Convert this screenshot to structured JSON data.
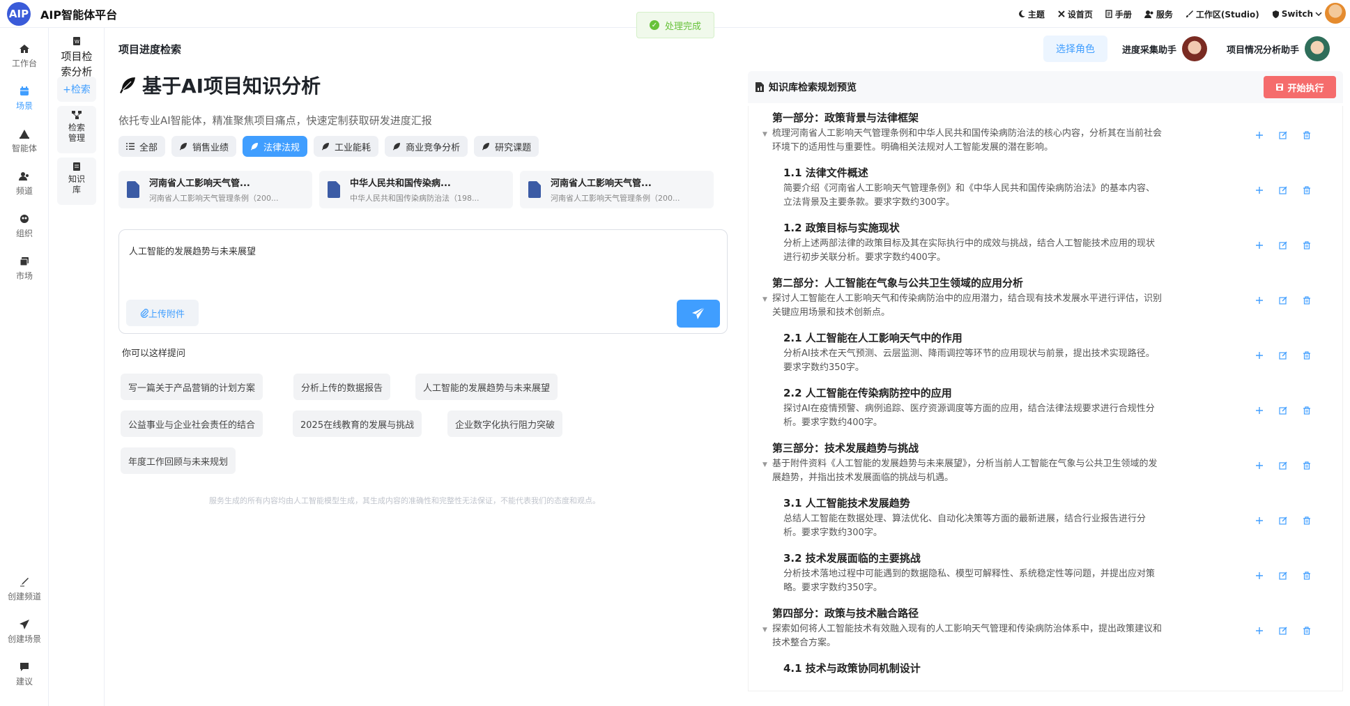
{
  "app": {
    "logo": "AIP",
    "name": "AIP智能体平台"
  },
  "toast": {
    "text": "处理完成"
  },
  "topnav": [
    {
      "icon": "moon-icon",
      "label": "主题"
    },
    {
      "icon": "tools-icon",
      "label": "设首页"
    },
    {
      "icon": "book-icon",
      "label": "手册"
    },
    {
      "icon": "users-icon",
      "label": "服务"
    },
    {
      "icon": "brush-icon",
      "label": "工作区(Studio)"
    },
    {
      "icon": "shield-icon",
      "label": "Switch"
    }
  ],
  "rail": {
    "top": [
      {
        "icon": "home-icon",
        "label": "工作台"
      },
      {
        "icon": "calendar-icon",
        "label": "场景",
        "active": true
      },
      {
        "icon": "agent-icon",
        "label": "智能体"
      },
      {
        "icon": "channel-icon",
        "label": "频道"
      },
      {
        "icon": "org-icon",
        "label": "组织"
      },
      {
        "icon": "market-icon",
        "label": "市场"
      }
    ],
    "bottom": [
      {
        "icon": "pen-icon",
        "label": "创建频道"
      },
      {
        "icon": "send-icon",
        "label": "创建场景"
      },
      {
        "icon": "chat-icon",
        "label": "建议"
      }
    ]
  },
  "submenu": {
    "project": "项目检索分析",
    "search": "+检索",
    "manage": "检索管理",
    "kb": "知识库"
  },
  "main": {
    "page_title": "项目进度检索",
    "hero_title": "基于AI项目知识分析",
    "hero_sub": "依托专业AI智能体，精准聚焦项目痛点，快速定制获取研发进度汇报",
    "chips": [
      "全部",
      "销售业绩",
      "法律法规",
      "工业能耗",
      "商业竞争分析",
      "研究课题"
    ],
    "active_chip": "法律法规",
    "files": [
      {
        "title": "河南省人工影响天气管...",
        "sub": "河南省人工影响天气管理条例（200..."
      },
      {
        "title": "中华人民共和国传染病...",
        "sub": "中华人民共和国传染病防治法（198..."
      },
      {
        "title": "河南省人工影响天气管...",
        "sub": "河南省人工影响天气管理条例（200..."
      }
    ],
    "input_value": "人工智能的发展趋势与未来展望",
    "upload_label": "上传附件",
    "suggest_label": "你可以这样提问",
    "suggestions": [
      "写一篇关于产品营销的计划方案",
      "分析上传的数据报告",
      "人工智能的发展趋势与未来展望",
      "公益事业与企业社会责任的结合",
      "2025在线教育的发展与挑战",
      "企业数字化执行阻力突破",
      "年度工作回顾与未来规划"
    ],
    "disclaimer": "服务生成的所有内容均由人工智能模型生成，其生成内容的准确性和完整性无法保证，不能代表我们的态度和观点。"
  },
  "right": {
    "role_button": "选择角色",
    "agents": [
      "进度采集助手",
      "项目情况分析助手"
    ],
    "panel_title": "知识库检索规划预览",
    "exec_button": "开始执行",
    "outline": [
      {
        "level": 1,
        "title": "第一部分：政策背景与法律框架",
        "desc": "梳理河南省人工影响天气管理条例和中华人民共和国传染病防治法的核心内容，分析其在当前社会环境下的适用性与重要性。明确相关法规对人工智能发展的潜在影响。"
      },
      {
        "level": 2,
        "title": "1.1 法律文件概述",
        "desc": "简要介绍《河南省人工影响天气管理条例》和《中华人民共和国传染病防治法》的基本内容、立法背景及主要条款。要求字数约300字。"
      },
      {
        "level": 2,
        "title": "1.2 政策目标与实施现状",
        "desc": "分析上述两部法律的政策目标及其在实际执行中的成效与挑战，结合人工智能技术应用的现状进行初步关联分析。要求字数约400字。"
      },
      {
        "level": 1,
        "title": "第二部分：人工智能在气象与公共卫生领域的应用分析",
        "desc": "探讨人工智能在人工影响天气和传染病防治中的应用潜力，结合现有技术发展水平进行评估，识别关键应用场景和技术创新点。"
      },
      {
        "level": 2,
        "title": "2.1 人工智能在人工影响天气中的作用",
        "desc": "分析AI技术在天气预测、云层监测、降雨调控等环节的应用现状与前景，提出技术实现路径。要求字数约350字。"
      },
      {
        "level": 2,
        "title": "2.2 人工智能在传染病防控中的应用",
        "desc": "探讨AI在疫情预警、病例追踪、医疗资源调度等方面的应用，结合法律法规要求进行合规性分析。要求字数约400字。"
      },
      {
        "level": 1,
        "title": "第三部分：技术发展趋势与挑战",
        "desc": "基于附件资料《人工智能的发展趋势与未来展望》，分析当前人工智能在气象与公共卫生领域的发展趋势，并指出技术发展面临的挑战与机遇。"
      },
      {
        "level": 2,
        "title": "3.1 人工智能技术发展趋势",
        "desc": "总结人工智能在数据处理、算法优化、自动化决策等方面的最新进展，结合行业报告进行分析。要求字数约300字。"
      },
      {
        "level": 2,
        "title": "3.2 技术发展面临的主要挑战",
        "desc": "分析技术落地过程中可能遇到的数据隐私、模型可解释性、系统稳定性等问题，并提出应对策略。要求字数约350字。"
      },
      {
        "level": 1,
        "title": "第四部分：政策与技术融合路径",
        "desc": "探索如何将人工智能技术有效融入现有的人工影响天气管理和传染病防治体系中，提出政策建议和技术整合方案。"
      },
      {
        "level": 2,
        "title": "4.1 技术与政策协同机制设计",
        "desc": ""
      }
    ]
  },
  "colors": {
    "accent": "#409eff",
    "danger": "#f56c6c",
    "success": "#67c23a",
    "logo": "#3a5bd9"
  }
}
